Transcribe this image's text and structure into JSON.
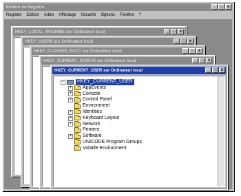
{
  "main_window": {
    "title": "Editeur du Registre",
    "menu": [
      "Registre",
      "Edition",
      "Arbre",
      "Affichage",
      "Sécurité",
      "Options",
      "Fenêtre",
      "?"
    ],
    "controls": [
      "_",
      "□",
      "x"
    ]
  },
  "child_windows": [
    {
      "title": "HKEY_LOCAL_MACHINE sur Ordinateur local"
    },
    {
      "title": "HKEY_USERS sur Ordinateur local"
    },
    {
      "title": "HKEY_CLASSES_ROOT sur Ordinateur local"
    },
    {
      "title": "HKEY_CURRENT_CONFIG sur Ordinateur local"
    },
    {
      "title": "HKEY_CURRENT_USER sur Ordinateur local"
    }
  ],
  "tree": {
    "root": "HKEY_CURRENT_USER",
    "items": [
      "AppEvents",
      "Console",
      "Control Panel",
      "Environment",
      "Identities",
      "Keyboard Layout",
      "Network",
      "Printers",
      "Software",
      "UNICODE Program Groups",
      "Volatile Environment"
    ]
  }
}
